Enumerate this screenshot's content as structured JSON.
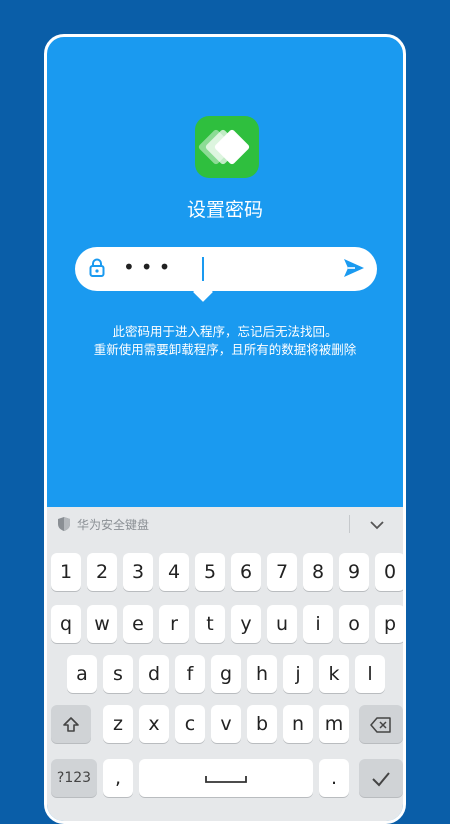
{
  "title": "设置密码",
  "password_field": {
    "masked_value": "•••"
  },
  "hint": {
    "line1": "此密码用于进入程序，忘记后无法找回。",
    "line2": "重新使用需要卸载程序，且所有的数据将被删除"
  },
  "keyboard": {
    "title": "华为安全键盘",
    "row_numbers": [
      "1",
      "2",
      "3",
      "4",
      "5",
      "6",
      "7",
      "8",
      "9",
      "0"
    ],
    "row_q": [
      "q",
      "w",
      "e",
      "r",
      "t",
      "y",
      "u",
      "i",
      "o",
      "p"
    ],
    "row_a": [
      "a",
      "s",
      "d",
      "f",
      "g",
      "h",
      "j",
      "k",
      "l"
    ],
    "row_z": [
      "z",
      "x",
      "c",
      "v",
      "b",
      "n",
      "m"
    ],
    "symbols_label": "?123",
    "comma": ",",
    "period": "."
  },
  "colors": {
    "background": "#0a5ea8",
    "screen": "#1a9af0",
    "app_icon": "#2fbf3e"
  },
  "icons": {
    "app": "app-logo-icon",
    "lock": "lock-icon",
    "send": "send-icon",
    "shield": "shield-icon",
    "collapse": "chevron-down-icon",
    "shift": "shift-icon",
    "backspace": "backspace-icon",
    "enter": "checkmark-icon",
    "space": "space-icon"
  }
}
